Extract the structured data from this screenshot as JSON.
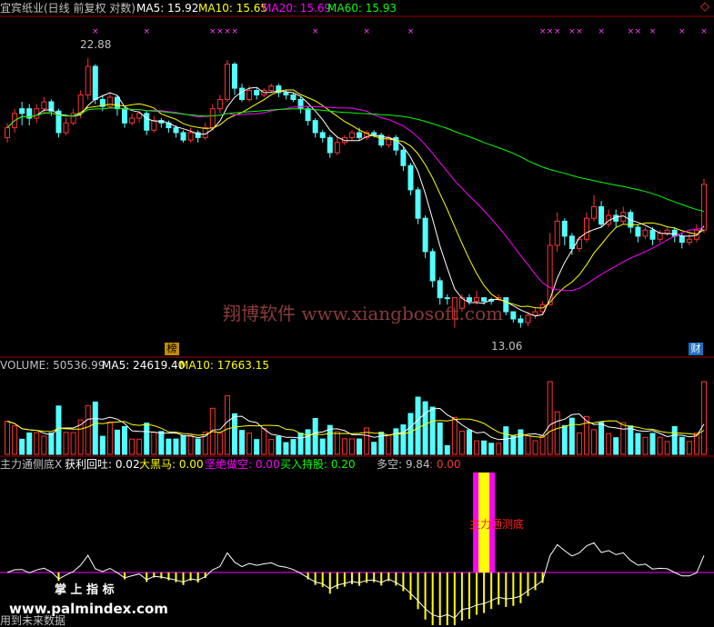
{
  "header": {
    "title": "宜宾纸业(日线 前复权 对数)",
    "ma5": "MA5: 15.92",
    "ma10": "MA10: 15.65",
    "ma20": "MA20: 15.69",
    "ma60": "MA60: 15.93",
    "corner_icon": "diamond-icon"
  },
  "price_panel": {
    "high_label": "22.88",
    "low_label": "13.06",
    "watermark": "翔博软件 www.xiangbosoft.com",
    "badge_left": "榜",
    "badge_right": "财"
  },
  "volume_panel": {
    "vol": "VOLUME: 50536.99",
    "ma5": "MA5: 24619.40",
    "ma10": "MA10: 17663.15"
  },
  "indicator_panel": {
    "name": "主力通侧底X",
    "items": [
      {
        "label": "获利回吐: 0.02",
        "color": "#ffffff"
      },
      {
        "label": "大黑马: 0.00",
        "color": "#ffff00"
      },
      {
        "label": "坚绝做空: 0.00",
        "color": "#ff00ff"
      },
      {
        "label": "买入持股: 0.20",
        "color": "#00ff00"
      }
    ],
    "duokong": "多空: 9.84",
    "duokong2": ": 0.00",
    "signal_label": "主力通测底",
    "watermark1": "掌 上 指 标",
    "watermark2": "www.palmindex.com",
    "watermark3": "用到未来数据"
  },
  "colors": {
    "up": "#ff3232",
    "down": "#54ffff",
    "ma5": "#ffffff",
    "ma10": "#ffff00",
    "ma20": "#ff00ff",
    "ma60": "#00ff00",
    "grid": "#990000"
  },
  "chart_data": {
    "type": "candlestick",
    "series_ma_labels": [
      "MA5",
      "MA10",
      "MA20",
      "MA60"
    ],
    "price_extremes": {
      "high": 22.88,
      "low": 13.06
    },
    "ma_last": {
      "MA5": 15.92,
      "MA10": 15.65,
      "MA20": 15.69,
      "MA60": 15.93
    },
    "candles": [
      [
        19.4,
        19.8,
        19.2,
        20.0,
        1
      ],
      [
        19.8,
        20.4,
        19.6,
        20.6,
        1
      ],
      [
        20.4,
        20.6,
        19.9,
        20.9,
        0
      ],
      [
        20.6,
        20.2,
        19.9,
        20.8,
        0
      ],
      [
        20.2,
        20.6,
        20.0,
        20.8,
        1
      ],
      [
        20.6,
        20.9,
        20.4,
        21.1,
        1
      ],
      [
        20.9,
        20.5,
        20.3,
        21.0,
        0
      ],
      [
        20.5,
        19.6,
        19.4,
        20.6,
        0
      ],
      [
        19.6,
        20.0,
        19.5,
        20.2,
        1
      ],
      [
        20.0,
        20.4,
        19.9,
        20.6,
        1
      ],
      [
        20.4,
        21.2,
        20.2,
        21.4,
        1
      ],
      [
        21.2,
        22.5,
        21.0,
        22.88,
        1
      ],
      [
        22.5,
        21.0,
        20.8,
        22.6,
        0
      ],
      [
        21.0,
        20.7,
        20.5,
        21.2,
        0
      ],
      [
        20.7,
        21.1,
        20.6,
        21.3,
        1
      ],
      [
        21.1,
        20.6,
        20.3,
        21.2,
        0
      ],
      [
        20.6,
        20.0,
        19.8,
        20.7,
        0
      ],
      [
        20.0,
        20.2,
        19.9,
        20.4,
        1
      ],
      [
        20.2,
        20.4,
        20.0,
        20.5,
        1
      ],
      [
        20.4,
        19.7,
        19.5,
        20.5,
        0
      ],
      [
        19.7,
        20.1,
        19.6,
        20.3,
        1
      ],
      [
        20.1,
        20.0,
        19.8,
        20.2,
        0
      ],
      [
        20.0,
        19.8,
        19.6,
        20.1,
        0
      ],
      [
        19.8,
        19.6,
        19.4,
        19.9,
        0
      ],
      [
        19.6,
        19.3,
        19.2,
        19.7,
        0
      ],
      [
        19.3,
        19.6,
        19.2,
        19.8,
        1
      ],
      [
        19.6,
        19.4,
        19.2,
        19.7,
        0
      ],
      [
        19.4,
        19.8,
        19.3,
        20.0,
        1
      ],
      [
        19.8,
        20.6,
        19.7,
        20.8,
        1
      ],
      [
        20.6,
        21.0,
        20.4,
        21.2,
        1
      ],
      [
        21.0,
        22.6,
        20.9,
        22.8,
        1
      ],
      [
        22.6,
        21.5,
        21.2,
        22.7,
        0
      ],
      [
        21.5,
        21.0,
        20.9,
        21.7,
        0
      ],
      [
        21.0,
        21.4,
        20.9,
        21.6,
        1
      ],
      [
        21.4,
        21.2,
        21.0,
        21.5,
        0
      ],
      [
        21.2,
        21.4,
        21.1,
        21.5,
        1
      ],
      [
        21.4,
        21.6,
        21.3,
        21.7,
        1
      ],
      [
        21.6,
        21.3,
        21.1,
        21.7,
        0
      ],
      [
        21.3,
        21.2,
        21.0,
        21.4,
        0
      ],
      [
        21.2,
        21.0,
        20.9,
        21.3,
        0
      ],
      [
        21.0,
        20.6,
        20.4,
        21.1,
        0
      ],
      [
        20.6,
        20.1,
        19.9,
        20.7,
        0
      ],
      [
        20.1,
        19.6,
        19.4,
        20.2,
        0
      ],
      [
        19.6,
        19.4,
        19.2,
        19.7,
        0
      ],
      [
        19.4,
        18.8,
        18.6,
        19.5,
        0
      ],
      [
        18.8,
        19.2,
        18.7,
        19.4,
        1
      ],
      [
        19.2,
        19.4,
        19.1,
        19.5,
        1
      ],
      [
        19.4,
        19.6,
        19.3,
        19.7,
        1
      ],
      [
        19.6,
        19.4,
        19.3,
        19.8,
        0
      ],
      [
        19.4,
        19.6,
        19.3,
        19.7,
        1
      ],
      [
        19.6,
        19.5,
        19.4,
        19.7,
        0
      ],
      [
        19.5,
        19.1,
        19.0,
        19.6,
        0
      ],
      [
        19.1,
        19.4,
        19.0,
        19.5,
        1
      ],
      [
        19.4,
        18.9,
        18.7,
        19.5,
        0
      ],
      [
        18.9,
        18.3,
        18.1,
        19.0,
        0
      ],
      [
        18.3,
        17.4,
        17.2,
        18.4,
        0
      ],
      [
        17.4,
        16.4,
        16.2,
        17.5,
        0
      ],
      [
        16.4,
        15.3,
        15.1,
        16.5,
        0
      ],
      [
        15.3,
        14.4,
        14.2,
        15.4,
        0
      ],
      [
        14.4,
        13.9,
        13.7,
        14.5,
        0
      ],
      [
        13.9,
        13.9,
        13.7,
        14.0,
        0
      ],
      [
        13.9,
        13.3,
        13.06,
        13.9,
        1
      ],
      [
        13.6,
        13.9,
        13.5,
        14.0,
        1
      ],
      [
        13.9,
        13.8,
        13.7,
        14.0,
        0
      ],
      [
        13.8,
        13.9,
        13.7,
        14.1,
        1
      ],
      [
        13.9,
        13.8,
        13.7,
        13.9,
        0
      ],
      [
        13.8,
        13.85,
        13.7,
        13.9,
        0
      ],
      [
        13.85,
        13.9,
        13.8,
        14.0,
        1
      ],
      [
        13.9,
        13.5,
        13.4,
        13.9,
        0
      ],
      [
        13.5,
        13.3,
        13.2,
        13.5,
        0
      ],
      [
        13.3,
        13.2,
        13.06,
        13.4,
        0
      ],
      [
        13.2,
        13.4,
        13.1,
        13.5,
        1
      ],
      [
        13.4,
        13.5,
        13.3,
        13.6,
        1
      ],
      [
        13.5,
        13.7,
        13.4,
        13.8,
        1
      ],
      [
        13.7,
        15.5,
        13.7,
        15.9,
        1
      ],
      [
        15.5,
        16.3,
        15.3,
        16.6,
        1
      ],
      [
        16.3,
        15.8,
        15.5,
        16.4,
        0
      ],
      [
        15.8,
        15.4,
        15.2,
        15.9,
        0
      ],
      [
        15.4,
        15.7,
        15.3,
        15.8,
        1
      ],
      [
        15.7,
        16.4,
        15.6,
        16.6,
        1
      ],
      [
        16.4,
        16.8,
        16.3,
        17.2,
        1
      ],
      [
        16.8,
        16.2,
        16.1,
        17.0,
        0
      ],
      [
        16.2,
        16.5,
        16.1,
        16.7,
        1
      ],
      [
        16.5,
        16.3,
        16.1,
        16.7,
        0
      ],
      [
        16.3,
        16.6,
        16.2,
        16.8,
        1
      ],
      [
        16.6,
        16.1,
        15.9,
        16.7,
        0
      ],
      [
        16.1,
        15.8,
        15.6,
        16.2,
        0
      ],
      [
        15.8,
        16.0,
        15.7,
        16.1,
        1
      ],
      [
        16.0,
        15.7,
        15.5,
        16.1,
        0
      ],
      [
        15.7,
        15.9,
        15.6,
        16.0,
        1
      ],
      [
        15.9,
        16.0,
        15.8,
        16.1,
        1
      ],
      [
        16.0,
        15.8,
        15.6,
        16.1,
        0
      ],
      [
        15.8,
        15.6,
        15.4,
        15.9,
        0
      ],
      [
        15.6,
        15.7,
        15.5,
        15.9,
        1
      ],
      [
        15.7,
        16.0,
        15.6,
        16.2,
        1
      ],
      [
        16.0,
        17.6,
        15.9,
        17.8,
        1
      ]
    ]
  }
}
